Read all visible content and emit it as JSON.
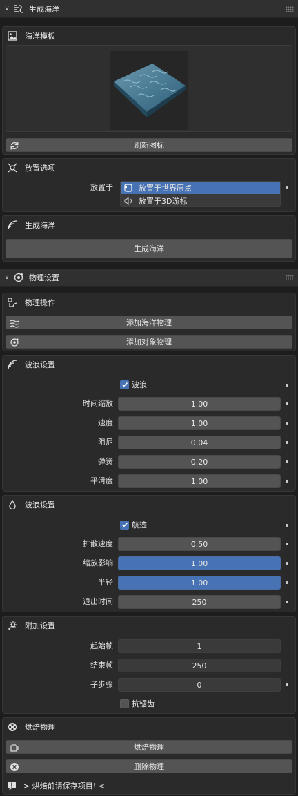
{
  "ocean_panel": {
    "title": "生成海洋",
    "template": {
      "title": "海洋模板",
      "refresh_label": "刷新图标"
    },
    "placement": {
      "title": "放置选项",
      "place_label": "放置于",
      "options": [
        "放置于世界原点",
        "放置于3D游标"
      ],
      "selected": 0
    },
    "generate": {
      "title": "生成海洋",
      "button_label": "生成海洋"
    }
  },
  "physics_panel": {
    "title": "物理设置",
    "ops": {
      "title": "物理操作",
      "add_ocean_label": "添加海洋物理",
      "add_object_label": "添加对象物理"
    },
    "wave": {
      "title": "波浪设置",
      "checkbox_label": "波浪",
      "checked": true,
      "fields": [
        {
          "label": "时间缩放",
          "value": "1.00"
        },
        {
          "label": "速度",
          "value": "1.00"
        },
        {
          "label": "阻尼",
          "value": "0.04"
        },
        {
          "label": "弹簧",
          "value": "0.20"
        },
        {
          "label": "平滑度",
          "value": "1.00"
        }
      ]
    },
    "trail": {
      "title": "波浪设置",
      "checkbox_label": "航迹",
      "checked": true,
      "fields": [
        {
          "label": "扩散速度",
          "value": "0.50",
          "highlight": false
        },
        {
          "label": "缩放影响",
          "value": "1.00",
          "highlight": true
        },
        {
          "label": "半径",
          "value": "1.00",
          "highlight": true
        },
        {
          "label": "退出时间",
          "value": "250",
          "highlight": false
        }
      ]
    },
    "extra": {
      "title": "附加设置",
      "fields": [
        {
          "label": "起始帧",
          "value": "1"
        },
        {
          "label": "结束帧",
          "value": "250"
        },
        {
          "label": "子步骤",
          "value": "0"
        }
      ],
      "antialias_label": "抗锯齿",
      "antialias_checked": false
    },
    "bake": {
      "title": "烘焙物理",
      "bake_label": "烘焙物理",
      "delete_label": "删除物理",
      "notice": "> 烘焙前请保存项目! <"
    }
  },
  "colors": {
    "accent": "#4772b3",
    "panel": "#303030",
    "box": "#2a2a2a",
    "button": "#545454"
  }
}
